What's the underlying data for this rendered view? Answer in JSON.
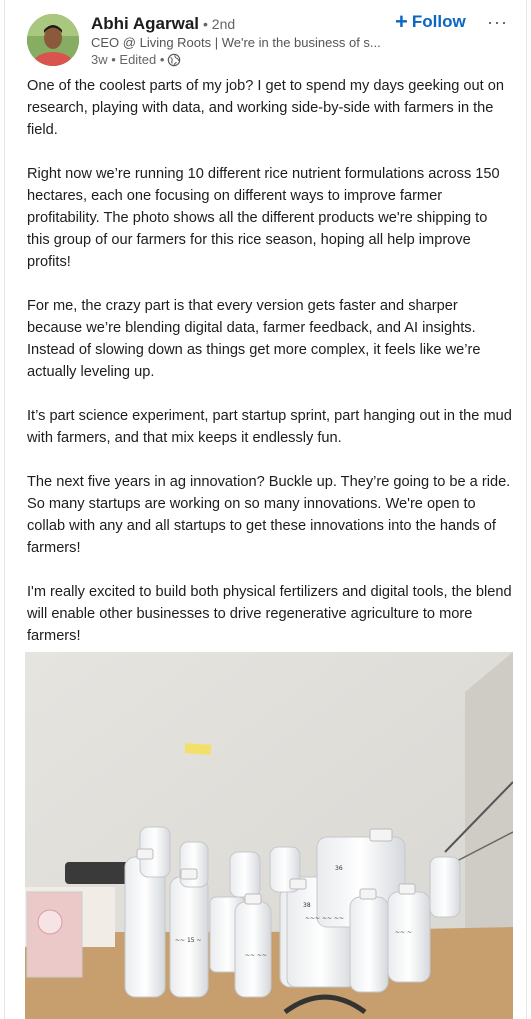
{
  "author": {
    "name": "Abhi Agarwal",
    "degree": "• 2nd",
    "headline": "CEO @ Living Roots | We're in the business of s...",
    "time": "3w • Edited •"
  },
  "actions": {
    "follow_label": "Follow",
    "follow_icon": "plus-icon",
    "more_icon": "more-icon"
  },
  "post": {
    "paragraphs": [
      "One of the coolest parts of my job? I get to spend my days geeking out on research, playing with data, and working side-by-side with farmers in the field.",
      "Right now we’re running 10 different rice nutrient formulations across 150 hectares, each one focusing on different ways to improve farmer profitability. The photo shows all the different products we're shipping to this group of our farmers for this rice season, hoping all help improve profits!",
      "For me, the crazy part is that every version gets faster and sharper because we’re blending digital data, farmer feedback, and AI insights. Instead of slowing down as things get more complex, it feels like we’re actually leveling up.",
      "It’s part science experiment, part startup sprint, part hanging out in the mud with farmers, and that mix keeps it endlessly fun.",
      "The next five years in ag innovation? Buckle up. They’re going to be a ride. So many startups are working on so many innovations. We're open to collab with any and all startups to get these innovations into the hands of farmers!",
      "I'm really excited to build both physical fertilizers and digital tools, the blend will enable other businesses to drive regenerative agriculture to more farmers!"
    ]
  },
  "colors": {
    "accent": "#0a66c2",
    "text": "#1d1d1d",
    "muted": "#666666"
  }
}
